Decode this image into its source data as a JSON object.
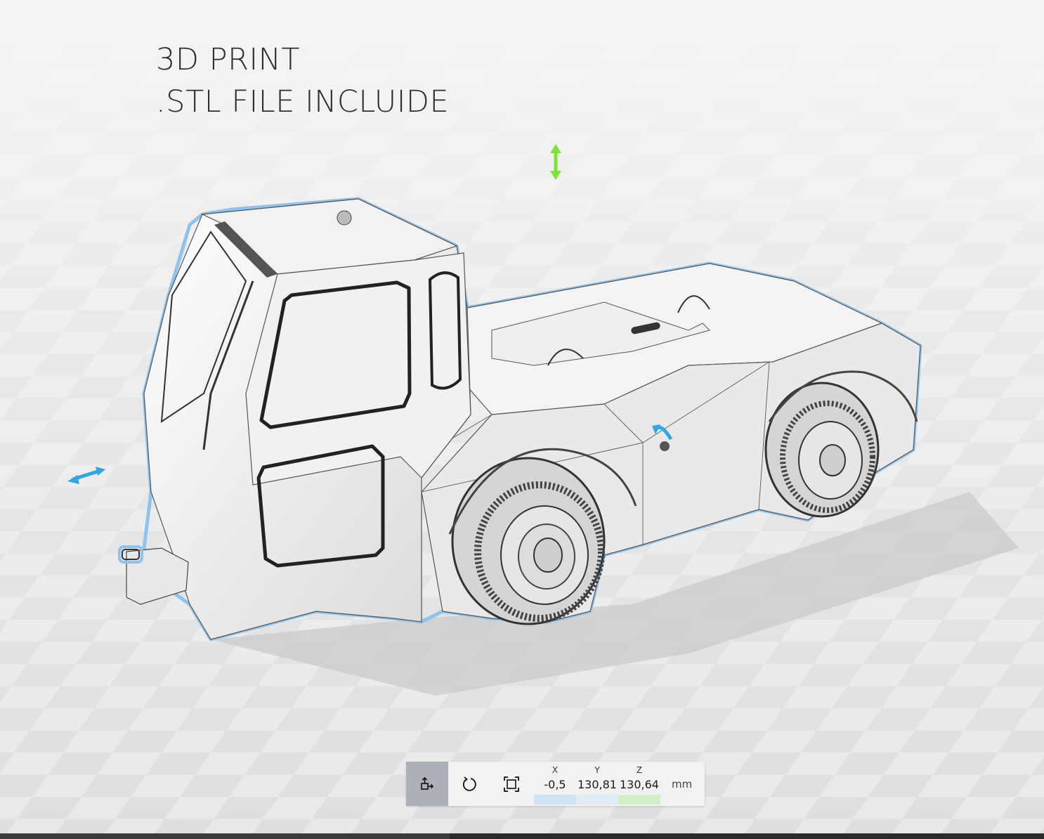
{
  "caption": {
    "line1": "3D PRINT",
    "line2": ".STL FILE INCLUIDE"
  },
  "scene": {
    "model": "vehicle-tug-wireframe",
    "selection_outline_color": "#8fc3ec",
    "gizmo_colors": {
      "vertical_arrow": "#7ee23a",
      "horizontal_arrow": "#2fa6e6",
      "rotate_arrow": "#2fa6e6"
    }
  },
  "toolbar": {
    "tools": [
      {
        "name": "move",
        "icon": "move-icon",
        "active": true
      },
      {
        "name": "rotate",
        "icon": "rotate-icon",
        "active": false
      },
      {
        "name": "scale",
        "icon": "scale-icon",
        "active": false
      }
    ],
    "coords": {
      "x": {
        "label": "X",
        "value": "-0,5",
        "color": "#cfe3f5"
      },
      "y": {
        "label": "Y",
        "value": "130,81",
        "color": "#e2ecf4"
      },
      "z": {
        "label": "Z",
        "value": "130,64",
        "color": "#d3efc8"
      }
    },
    "unit": "mm"
  }
}
